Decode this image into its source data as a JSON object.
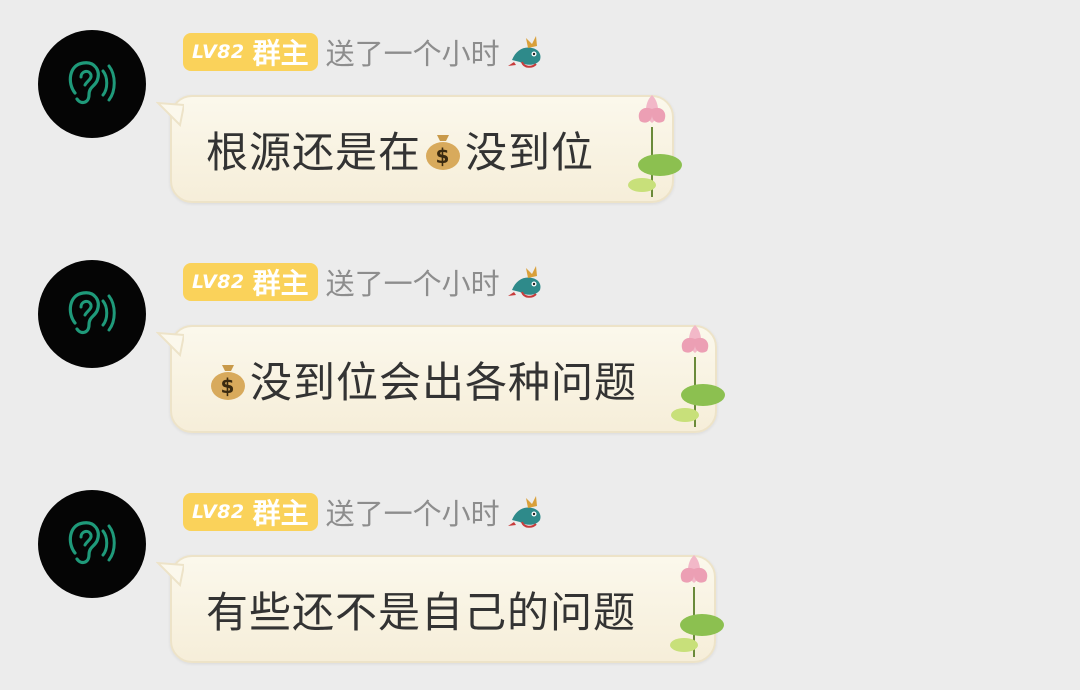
{
  "messages": [
    {
      "level": "LV82",
      "role": "群主",
      "action": "送了一个小时",
      "text_before": "根源还是在",
      "money_icon": true,
      "text_after": "没到位"
    },
    {
      "level": "LV82",
      "role": "群主",
      "action": "送了一个小时",
      "text_before": "",
      "money_icon": true,
      "text_after": "没到位会出各种问题"
    },
    {
      "level": "LV82",
      "role": "群主",
      "action": "送了一个小时",
      "text_before": "有些还不是自己的问题",
      "money_icon": false,
      "text_after": ""
    }
  ],
  "colors": {
    "background": "#ececec",
    "badge": "#fad25a",
    "avatar_bg": "#050505",
    "avatar_icon": "#1f9a7a",
    "bubble": "#f8f2e1"
  }
}
